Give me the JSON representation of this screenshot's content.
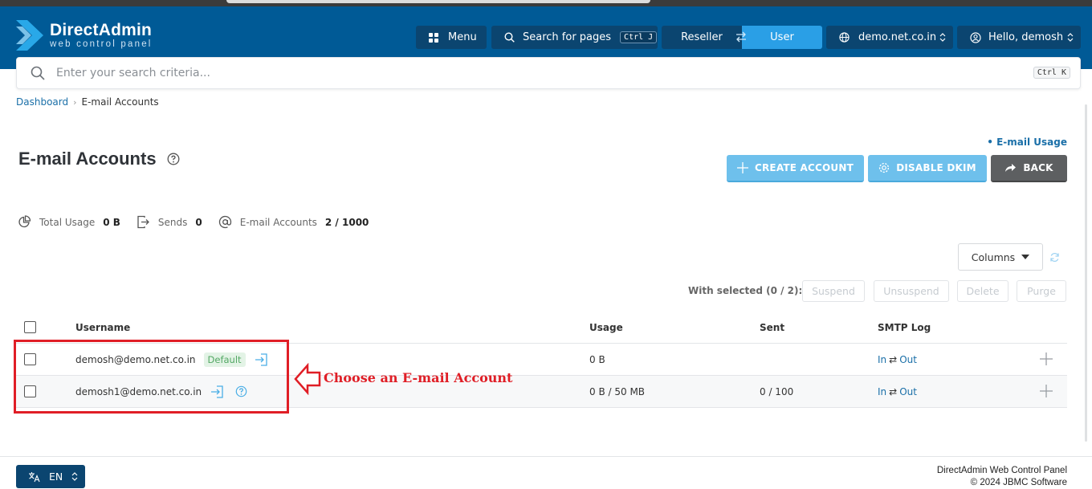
{
  "brand": {
    "title": "DirectAdmin",
    "subtitle": "web control panel"
  },
  "header": {
    "menu_label": "Menu",
    "search_pages_label": "Search for pages",
    "search_pages_shortcut": "Ctrl J",
    "reseller_label": "Reseller",
    "user_label": "User",
    "domain_label": "demo.net.co.in",
    "greeting_label": "Hello, demosh"
  },
  "search": {
    "placeholder": "Enter your search criteria...",
    "shortcut": "Ctrl K"
  },
  "breadcrumb": {
    "home": "Dashboard",
    "current": "E-mail Accounts"
  },
  "page": {
    "title": "E-mail Accounts",
    "usage_link": "• E-mail Usage",
    "create_label": "CREATE ACCOUNT",
    "dkim_label": "DISABLE DKIM",
    "back_label": "BACK"
  },
  "stats": {
    "total_usage_label": "Total Usage",
    "total_usage_value": "0 B",
    "sends_label": "Sends",
    "sends_value": "0",
    "accounts_label": "E-mail Accounts",
    "accounts_value": "2 / 1000"
  },
  "toolbar": {
    "columns_label": "Columns",
    "with_selected": "With selected (0 / 2):",
    "suspend": "Suspend",
    "unsuspend": "Unsuspend",
    "delete": "Delete",
    "purge": "Purge"
  },
  "table": {
    "headers": {
      "username": "Username",
      "usage": "Usage",
      "sent": "Sent",
      "smtp": "SMTP Log"
    },
    "rows": [
      {
        "username": "demosh@demo.net.co.in",
        "badge": "Default",
        "usage": "0 B",
        "sent": "",
        "smtp_in": "In",
        "smtp_sep": "⇄",
        "smtp_out": "Out"
      },
      {
        "username": "demosh1@demo.net.co.in",
        "badge": "",
        "usage": "0 B / 50 MB",
        "sent": "0 / 100",
        "smtp_in": "In",
        "smtp_sep": "⇄",
        "smtp_out": "Out"
      }
    ]
  },
  "annotation": {
    "text": "Choose an E-mail Account",
    "color": "#e01e26"
  },
  "footer": {
    "lang": "EN",
    "line1": "DirectAdmin Web Control Panel",
    "line2": "© 2024 JBMC Software"
  },
  "colors": {
    "header": "#005a96",
    "accent": "#2a9fe6",
    "button_light": "#6ec0ec",
    "button_dark": "#5d5f61"
  }
}
